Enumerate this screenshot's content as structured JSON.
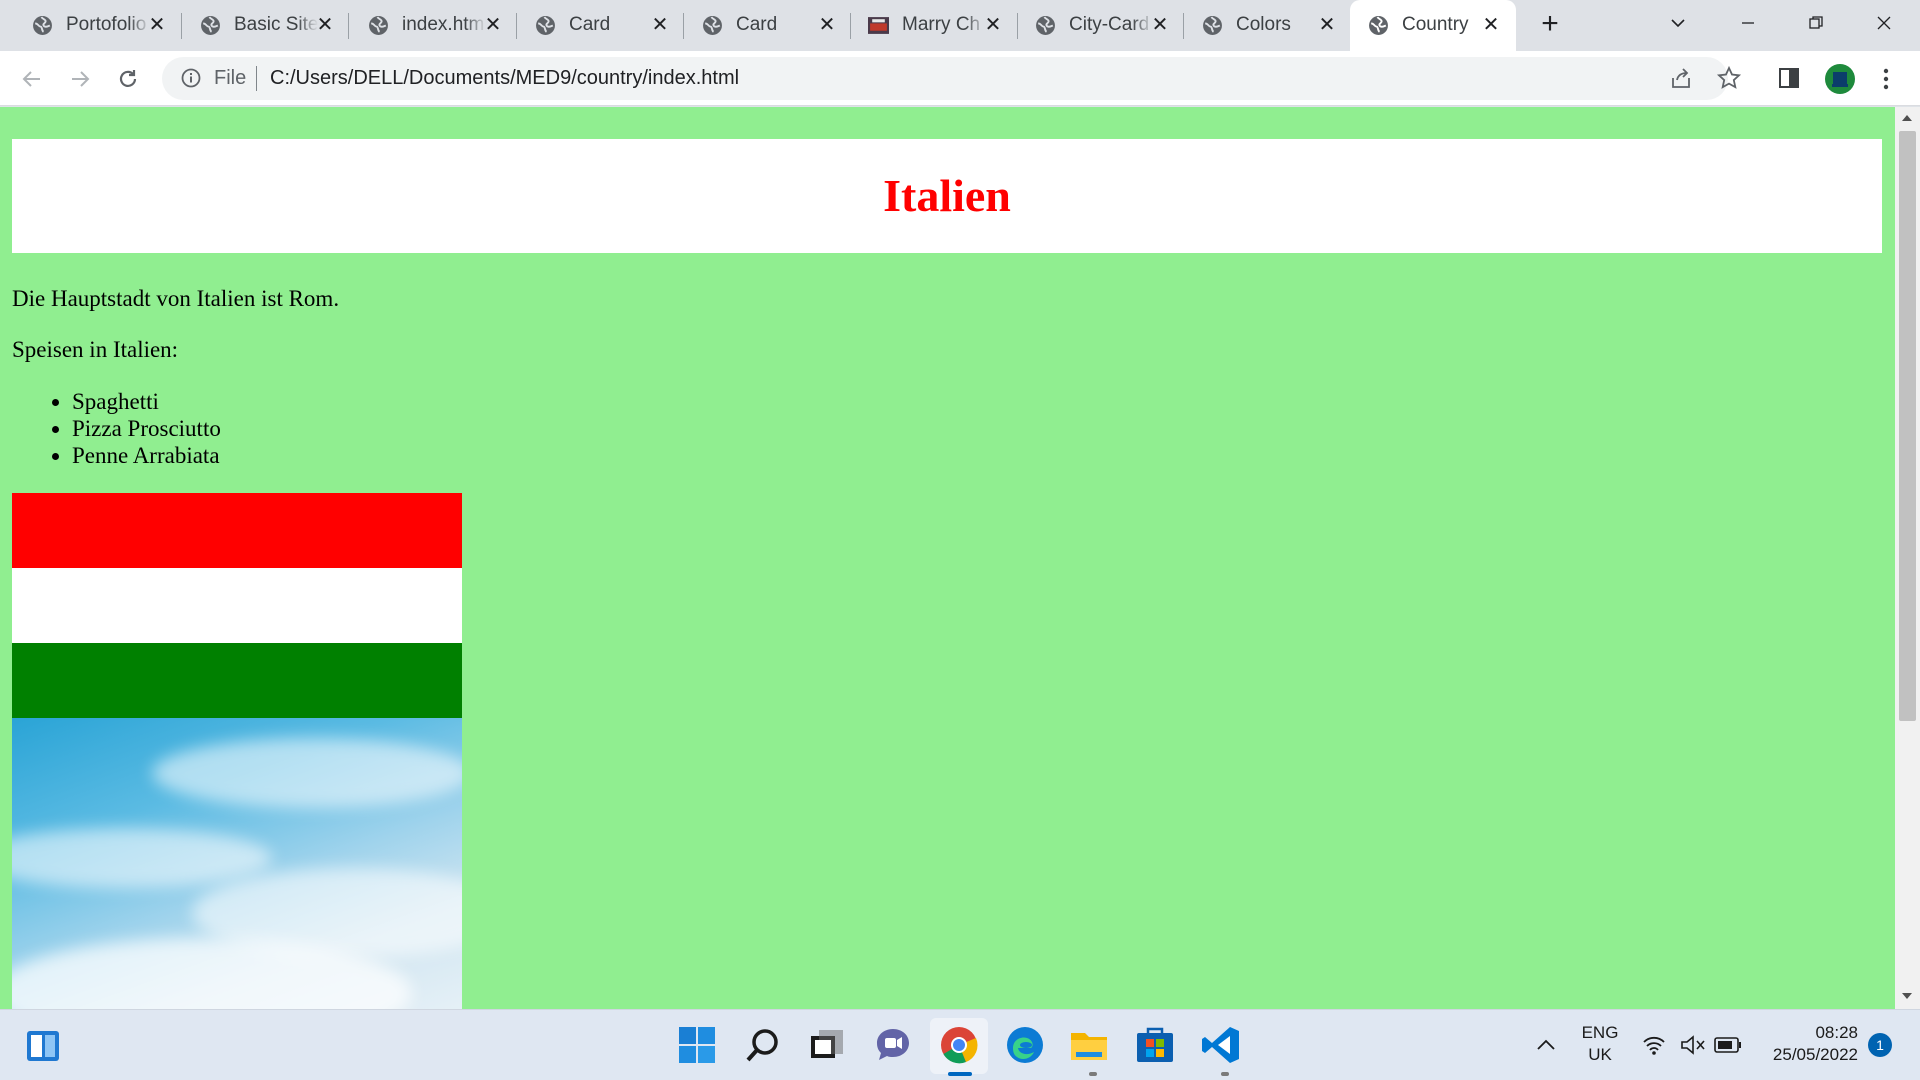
{
  "tabs": [
    {
      "title": "Portofolio",
      "icon": "globe-icon"
    },
    {
      "title": "Basic Site",
      "icon": "globe-icon"
    },
    {
      "title": "index.html",
      "icon": "globe-icon"
    },
    {
      "title": "Card",
      "icon": "globe-icon"
    },
    {
      "title": "Card",
      "icon": "globe-icon"
    },
    {
      "title": "Marry Ch",
      "icon": "site-thumbnail-icon"
    },
    {
      "title": "City-Card",
      "icon": "globe-icon"
    },
    {
      "title": "Colors",
      "icon": "globe-icon"
    },
    {
      "title": "Country",
      "icon": "globe-icon",
      "active": true
    }
  ],
  "omnibox": {
    "scheme": "File",
    "url": "C:/Users/DELL/Documents/MED9/country/index.html"
  },
  "page": {
    "heading": "Italien",
    "capital_text": "Die Hauptstadt von Italien ist Rom.",
    "food_intro": "Speisen in Italien:",
    "foods": [
      "Spaghetti",
      "Pizza Prosciutto",
      "Penne Arrabiata"
    ],
    "flag_colors": [
      "#ff0000",
      "#ffffff",
      "#008000"
    ],
    "background_color": "#90ee90",
    "heading_color": "#ff0000"
  },
  "taskbar": {
    "language_line1": "ENG",
    "language_line2": "UK",
    "time": "08:28",
    "date": "25/05/2022",
    "notification_count": "1"
  }
}
